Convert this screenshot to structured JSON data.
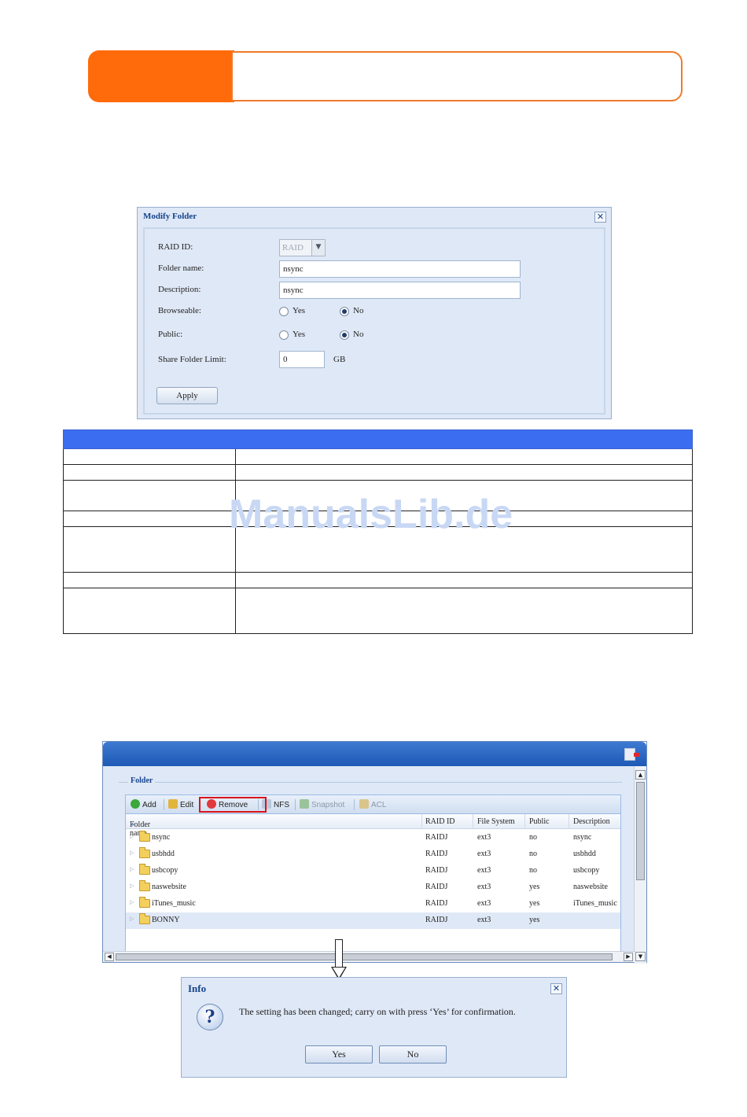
{
  "modify_dialog": {
    "title": "Modify Folder",
    "raid_label": "RAID ID:",
    "raid_value": "RAID",
    "folder_name_label": "Folder name:",
    "folder_name_value": "nsync",
    "description_label": "Description:",
    "description_value": "nsync",
    "browseable_label": "Browseable:",
    "public_label": "Public:",
    "yes": "Yes",
    "no": "No",
    "browseable_selected": "No",
    "public_selected": "No",
    "limit_label": "Share Folder Limit:",
    "limit_value": "0",
    "limit_unit": "GB",
    "apply": "Apply"
  },
  "watermark": "ManualsLib.de",
  "folder_panel": {
    "legend": "Folder",
    "toolbar": {
      "add": "Add",
      "edit": "Edit",
      "remove": "Remove",
      "nfs": "NFS",
      "snapshot": "Snapshot",
      "acl": "ACL"
    },
    "columns": [
      "Folder name",
      "RAID ID",
      "File System",
      "Public",
      "Description"
    ],
    "rows": [
      {
        "name": "nsync",
        "raid": "RAIDJ",
        "fs": "ext3",
        "public": "no",
        "desc": "nsync"
      },
      {
        "name": "usbhdd",
        "raid": "RAIDJ",
        "fs": "ext3",
        "public": "no",
        "desc": "usbhdd"
      },
      {
        "name": "usbcopy",
        "raid": "RAIDJ",
        "fs": "ext3",
        "public": "no",
        "desc": "usbcopy"
      },
      {
        "name": "naswebsite",
        "raid": "RAIDJ",
        "fs": "ext3",
        "public": "yes",
        "desc": "naswebsite"
      },
      {
        "name": "iTunes_music",
        "raid": "RAIDJ",
        "fs": "ext3",
        "public": "yes",
        "desc": "iTunes_music"
      },
      {
        "name": "BONNY",
        "raid": "RAIDJ",
        "fs": "ext3",
        "public": "yes",
        "desc": ""
      }
    ]
  },
  "info_dialog": {
    "title": "Info",
    "message": "The setting has been changed; carry on with press ‘Yes’ for confirmation.",
    "yes": "Yes",
    "no": "No"
  },
  "colors": {
    "header_orange": "#ff6a0a",
    "table_header_blue": "#3b6df0",
    "remove_highlight": "#d8151c"
  }
}
